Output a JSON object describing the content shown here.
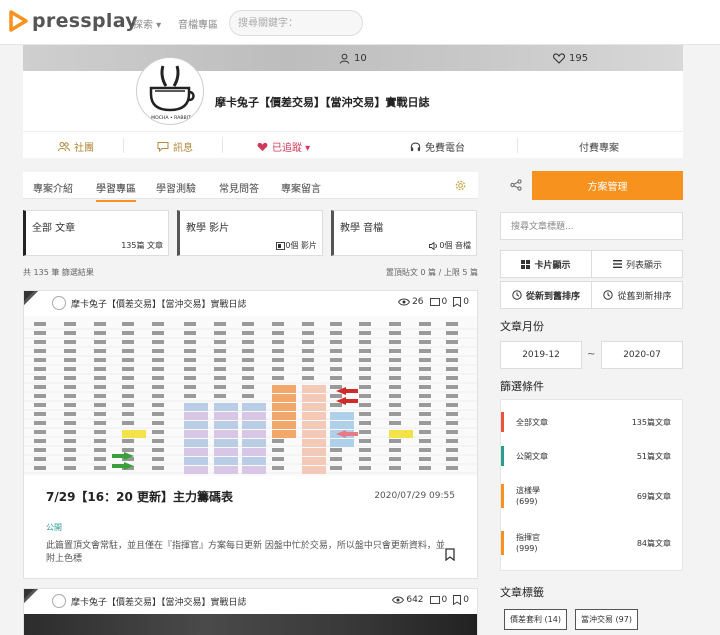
{
  "nav": {
    "brand": "pressplay",
    "explore": "探索 ▾",
    "music_zone": "音檔專區",
    "search_placeholder": "搜尋關鍵字："
  },
  "profile": {
    "members": "10",
    "likes": "195",
    "title": "摩卡兔子【價差交易】【當沖交易】實戰日誌",
    "avatar_text": "MOCHA • RABBIT",
    "actions": {
      "community": "社團",
      "messages": "訊息",
      "subscribed": "已追蹤 ▾",
      "radio": "免費電台",
      "plans": "付費專案"
    }
  },
  "tabs": [
    "專案介紹",
    "學習專區",
    "學習測驗",
    "常見問答",
    "專案留言"
  ],
  "active_tab": 1,
  "categories": [
    {
      "name": "全部 文章",
      "count": "135篇 文章"
    },
    {
      "name": "教學 影片",
      "count": "0個 影片"
    },
    {
      "name": "教學 音檔",
      "count": "0個 音檔"
    }
  ],
  "results": {
    "total": "共 135 筆 篩選結果",
    "pinned": "置頂貼文 0 篇 / 上限 5 篇"
  },
  "posts": [
    {
      "author": "摩卡兔子【價差交易】【當沖交易】實戰日誌",
      "views": "26",
      "comments": "0",
      "bookmarks": "0",
      "title": "7/29【16：20 更新】主力籌碼表",
      "date": "2020/07/29 09:55",
      "tag": "公開",
      "excerpt": "此篇置頂文會常駐，並且僅在『指揮官』方案每日更新 因盤中忙於交易，所以盤中只會更新資料，並附上色標"
    },
    {
      "author": "摩卡兔子【價差交易】【當沖交易】實戰日誌",
      "views": "642",
      "comments": "0",
      "bookmarks": "0"
    }
  ],
  "sidebar": {
    "plan_button": "方案管理",
    "search_placeholder": "搜尋文章標題...",
    "view_card": "卡片顯示",
    "view_list": "列表顯示",
    "sort_new": "從新到舊排序",
    "sort_old": "從舊到新排序",
    "month_heading": "文章月份",
    "month_from": "2019-12",
    "month_sep": "~",
    "month_to": "2020-07",
    "filter_heading": "篩選條件",
    "filters": [
      {
        "name": "全部文章",
        "count": "135篇文章",
        "color": "#e8553a"
      },
      {
        "name": "公開文章",
        "count": "51篇文章",
        "color": "#2a9d8f"
      },
      {
        "name": "這樣學",
        "sub": "(699)",
        "count": "69篇文章",
        "color": "#f7921e"
      },
      {
        "name": "指揮官",
        "sub": "(999)",
        "count": "84篇文章",
        "color": "#f7921e"
      }
    ],
    "tags_heading": "文章標籤",
    "tags": [
      "價差套利 (14)",
      "當沖交易 (97)"
    ]
  },
  "colors": {
    "accent": "#f7921e",
    "public": "#2a9d8f",
    "subscribed": "#d03a5a"
  }
}
